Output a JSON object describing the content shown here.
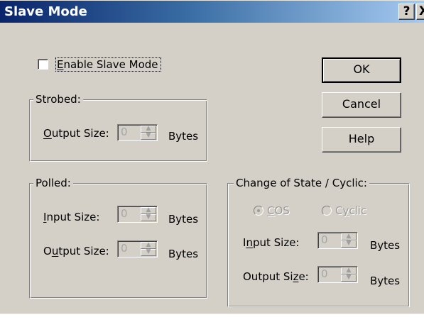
{
  "window": {
    "title": "Slave Mode",
    "help_button": "?",
    "close_button": "X"
  },
  "enable_slave_mode": {
    "label_underlined": "E",
    "label_rest": "nable Slave Mode",
    "checked": false
  },
  "buttons": {
    "ok": "OK",
    "cancel": "Cancel",
    "help": "Help"
  },
  "strobed": {
    "title": "Strobed:",
    "output_label_underlined": "O",
    "output_label_rest": "utput Size:",
    "output_value": "0",
    "units": "Bytes"
  },
  "polled": {
    "title": "Polled:",
    "input_label_underlined": "I",
    "input_label_rest": "nput Size:",
    "input_value": "0",
    "output_label_start": "O",
    "output_label_underlined": "u",
    "output_label_rest": "tput Size:",
    "output_value": "0",
    "units": "Bytes"
  },
  "change_of_state": {
    "title": "Change of State / Cyclic:",
    "cos_label_underlined": "C",
    "cos_label_rest": "OS",
    "cyclic_label_start": "C",
    "cyclic_label_underlined": "y",
    "cyclic_label_rest": "clic",
    "cos_selected": true,
    "input_label_start": "I",
    "input_label_underlined": "n",
    "input_label_rest": "put Size:",
    "input_value": "0",
    "output_label_start": "Output Si",
    "output_label_underlined": "z",
    "output_label_rest": "e:",
    "output_value": "0",
    "units": "Bytes"
  },
  "icons": {
    "spin_up": "spin-up-icon",
    "spin_down": "spin-down-icon",
    "radio_selected": "radio-selected-icon",
    "radio_unselected": "radio-unselected-icon"
  },
  "colors": {
    "dialog_bg": "#d4d0c8",
    "titlebar_start": "#0a246a",
    "titlebar_end": "#a6caf0",
    "disabled_text": "#9b9b9b"
  }
}
